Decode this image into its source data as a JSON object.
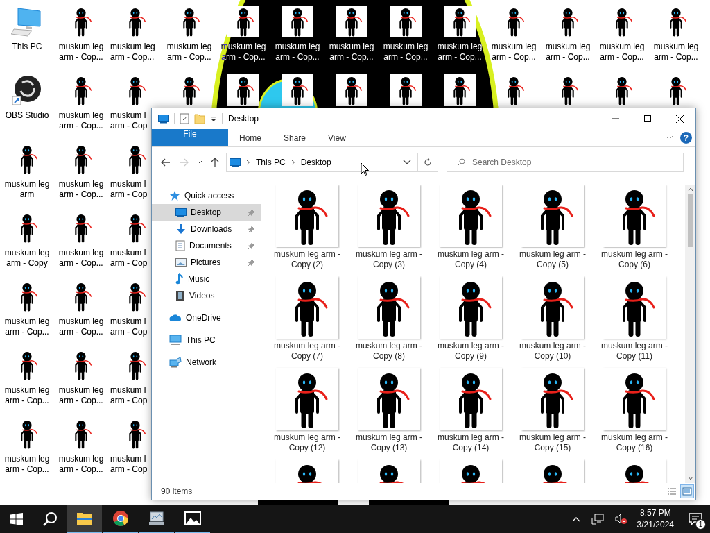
{
  "desktop": {
    "columns": [
      [
        {
          "kind": "pc",
          "lines": [
            "This PC"
          ]
        },
        {
          "kind": "obs",
          "lines": [
            "OBS Studio"
          ]
        },
        {
          "kind": "image",
          "lines": [
            "muskum leg",
            "arm"
          ]
        },
        {
          "kind": "image",
          "lines": [
            "muskum leg",
            "arm - Copy"
          ]
        },
        {
          "kind": "image",
          "lines": [
            "muskum leg",
            "arm - Cop..."
          ]
        },
        {
          "kind": "image",
          "lines": [
            "muskum leg",
            "arm - Cop..."
          ]
        },
        {
          "kind": "image",
          "lines": [
            "muskum leg",
            "arm - Cop..."
          ]
        }
      ],
      [
        {
          "kind": "image",
          "lines": [
            "muskum leg",
            "arm - Cop..."
          ]
        },
        {
          "kind": "image",
          "lines": [
            "muskum leg",
            "arm - Cop..."
          ]
        },
        {
          "kind": "image",
          "lines": [
            "muskum leg",
            "arm - Cop..."
          ]
        },
        {
          "kind": "image",
          "lines": [
            "muskum leg",
            "arm - Cop..."
          ]
        },
        {
          "kind": "image",
          "lines": [
            "muskum leg",
            "arm - Cop..."
          ]
        },
        {
          "kind": "image",
          "lines": [
            "muskum leg",
            "arm - Cop..."
          ]
        },
        {
          "kind": "image",
          "lines": [
            "muskum leg",
            "arm - Cop..."
          ]
        }
      ],
      [
        {
          "kind": "image",
          "lines": [
            "muskum leg",
            "arm - Cop..."
          ]
        },
        {
          "kind": "image",
          "lines": [
            "muskum l",
            "arm - Cop"
          ]
        },
        {
          "kind": "image",
          "lines": [
            "muskum l",
            "arm - Cop"
          ]
        },
        {
          "kind": "image",
          "lines": [
            "muskum l",
            "arm - Cop"
          ]
        },
        {
          "kind": "image",
          "lines": [
            "muskum l",
            "arm - Cop"
          ]
        },
        {
          "kind": "image",
          "lines": [
            "muskum l",
            "arm - Cop"
          ]
        },
        {
          "kind": "image",
          "lines": [
            "muskum l",
            "arm - Cop"
          ]
        }
      ],
      [
        {
          "kind": "image",
          "lines": [
            "muskum leg",
            "arm - Cop..."
          ]
        },
        {
          "kind": "image"
        }
      ],
      [
        {
          "kind": "image",
          "lines": [
            "muskum leg",
            "arm - Cop..."
          ]
        },
        {
          "kind": "image"
        }
      ],
      [
        {
          "kind": "image",
          "lines": [
            "muskum leg",
            "arm - Cop..."
          ]
        },
        {
          "kind": "image"
        }
      ],
      [
        {
          "kind": "image",
          "lines": [
            "muskum leg",
            "arm - Cop..."
          ]
        },
        {
          "kind": "image"
        }
      ],
      [
        {
          "kind": "image",
          "lines": [
            "muskum leg",
            "arm - Cop..."
          ]
        },
        {
          "kind": "image"
        }
      ],
      [
        {
          "kind": "image",
          "lines": [
            "muskum leg",
            "arm - Cop..."
          ]
        },
        {
          "kind": "image"
        }
      ],
      [
        {
          "kind": "image",
          "lines": [
            "muskum leg",
            "arm - Cop..."
          ]
        },
        {
          "kind": "image"
        }
      ],
      [
        {
          "kind": "image",
          "lines": [
            "muskum leg",
            "arm - Cop..."
          ]
        },
        {
          "kind": "image"
        }
      ],
      [
        {
          "kind": "image",
          "lines": [
            "muskum leg",
            "arm - Cop..."
          ]
        },
        {
          "kind": "image"
        }
      ],
      [
        {
          "kind": "image",
          "lines": [
            "muskum leg",
            "arm - Cop..."
          ]
        },
        {
          "kind": "image"
        }
      ]
    ]
  },
  "window": {
    "title": "Desktop",
    "ribbon_tabs": [
      {
        "label": "File",
        "kind": "file"
      },
      {
        "label": "Home",
        "kind": "tab"
      },
      {
        "label": "Share",
        "kind": "tab"
      },
      {
        "label": "View",
        "kind": "tab"
      }
    ],
    "help": "?",
    "address": {
      "crumbs": [
        "This PC",
        "Desktop"
      ]
    },
    "search": {
      "placeholder": "Search Desktop"
    },
    "nav": [
      {
        "label": "Quick access",
        "kind": "star",
        "children": [
          {
            "label": "Desktop",
            "kind": "desktop",
            "pinned": true,
            "selected": true
          },
          {
            "label": "Downloads",
            "kind": "download",
            "pinned": true,
            "selected": false
          },
          {
            "label": "Documents",
            "kind": "document",
            "pinned": true,
            "selected": false
          },
          {
            "label": "Pictures",
            "kind": "picture",
            "pinned": true,
            "selected": false
          },
          {
            "label": "Music",
            "kind": "music",
            "pinned": false,
            "selected": false
          },
          {
            "label": "Videos",
            "kind": "video",
            "pinned": false,
            "selected": false
          }
        ]
      },
      {
        "label": "OneDrive",
        "kind": "cloud"
      },
      {
        "label": "This PC",
        "kind": "pc"
      },
      {
        "label": "Network",
        "kind": "network"
      }
    ],
    "files": [
      {
        "kind": "image",
        "name": "muskum leg arm - Copy (2)"
      },
      {
        "kind": "image",
        "name": "muskum leg arm - Copy (3)"
      },
      {
        "kind": "image",
        "name": "muskum leg arm - Copy (4)"
      },
      {
        "kind": "image",
        "name": "muskum leg arm - Copy (5)"
      },
      {
        "kind": "image",
        "name": "muskum leg arm - Copy (6)"
      },
      {
        "kind": "image",
        "name": "muskum leg arm - Copy (7)"
      },
      {
        "kind": "image",
        "name": "muskum leg arm - Copy (8)"
      },
      {
        "kind": "image",
        "name": "muskum leg arm - Copy (9)"
      },
      {
        "kind": "image",
        "name": "muskum leg arm - Copy (10)"
      },
      {
        "kind": "image",
        "name": "muskum leg arm - Copy (11)"
      },
      {
        "kind": "image",
        "name": "muskum leg arm - Copy (12)"
      },
      {
        "kind": "image",
        "name": "muskum leg arm - Copy (13)"
      },
      {
        "kind": "image",
        "name": "muskum leg arm - Copy (14)"
      },
      {
        "kind": "image",
        "name": "muskum leg arm - Copy (15)"
      },
      {
        "kind": "image",
        "name": "muskum leg arm - Copy (16)"
      },
      {
        "kind": "image"
      },
      {
        "kind": "image"
      },
      {
        "kind": "image"
      },
      {
        "kind": "image"
      },
      {
        "kind": "image"
      }
    ],
    "status": "90 items",
    "views": [
      {
        "kind": "details",
        "selected": false
      },
      {
        "kind": "large",
        "selected": true
      }
    ]
  },
  "taskbar": {
    "apps": [
      {
        "kind": "explorer",
        "selected": true
      },
      {
        "kind": "chrome",
        "selected": false
      },
      {
        "kind": "monitor",
        "selected": false
      },
      {
        "kind": "photos",
        "selected": false
      }
    ],
    "time": "8:57 PM",
    "date": "3/21/2024",
    "notifications": "1"
  }
}
